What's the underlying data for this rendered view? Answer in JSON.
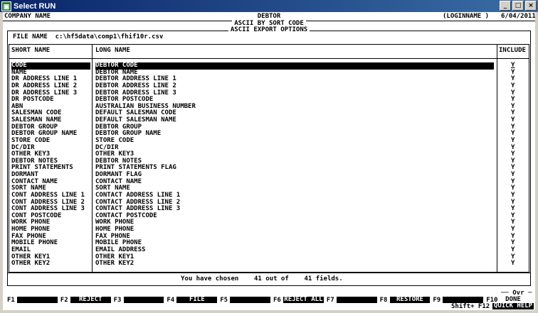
{
  "window": {
    "title": "Select RUN"
  },
  "header": {
    "company": "COMPANY NAME",
    "title": "DEBTOR",
    "subtitle": "ASCII BY SORT CODE",
    "user": "(LOGINNAME )",
    "date": "6/04/2011"
  },
  "box_title": "ASCII EXPORT OPTIONS",
  "file": {
    "label": "FILE NAME",
    "value": "c:\\hf5data\\comp1\\fhif10r.csv"
  },
  "table": {
    "headers": {
      "short": "SHORT NAME",
      "long": "LONG NAME",
      "include": "INCLUDE"
    },
    "rows": [
      {
        "short": "CODE",
        "long": "DEBTOR CODE",
        "include": "Y"
      },
      {
        "short": "NAME",
        "long": "DEBTOR NAME",
        "include": "Y"
      },
      {
        "short": "DR ADDRESS LINE 1",
        "long": "DEBTOR ADDRESS LINE 1",
        "include": "Y"
      },
      {
        "short": "DR ADDRESS LINE 2",
        "long": "DEBTOR ADDRESS LINE 2",
        "include": "Y"
      },
      {
        "short": "DR ADDRESS LINE 3",
        "long": "DEBTOR ADDRESS LINE 3",
        "include": "Y"
      },
      {
        "short": "DR POSTCODE",
        "long": "DEBTOR POSTCODE",
        "include": "Y"
      },
      {
        "short": "ABN",
        "long": "AUSTRALIAN BUSINESS NUMBER",
        "include": "Y"
      },
      {
        "short": "SALESMAN CODE",
        "long": "DEFAULT SALESMAN CODE",
        "include": "Y"
      },
      {
        "short": "SALESMAN NAME",
        "long": "DEFAULT SALESMAN NAME",
        "include": "Y"
      },
      {
        "short": "DEBTOR GROUP",
        "long": "DEBTOR GROUP",
        "include": "Y"
      },
      {
        "short": "DEBTOR GROUP NAME",
        "long": "DEBTOR GROUP NAME",
        "include": "Y"
      },
      {
        "short": "STORE CODE",
        "long": "STORE CODE",
        "include": "Y"
      },
      {
        "short": "DC/DIR",
        "long": "DC/DIR",
        "include": "Y"
      },
      {
        "short": "OTHER KEY3",
        "long": "OTHER KEY3",
        "include": "Y"
      },
      {
        "short": "DEBTOR NOTES",
        "long": "DEBTOR NOTES",
        "include": "Y"
      },
      {
        "short": "PRINT STATEMENTS",
        "long": "PRINT STATEMENTS FLAG",
        "include": "Y"
      },
      {
        "short": "DORMANT",
        "long": "DORMANT FLAG",
        "include": "Y"
      },
      {
        "short": "CONTACT NAME",
        "long": "CONTACT NAME",
        "include": "Y"
      },
      {
        "short": "SORT NAME",
        "long": "SORT NAME",
        "include": "Y"
      },
      {
        "short": "CONT ADDRESS LINE 1",
        "long": "CONTACT ADDRESS LINE 1",
        "include": "Y"
      },
      {
        "short": "CONT ADDRESS LINE 2",
        "long": "CONTACT ADDRESS LINE 2",
        "include": "Y"
      },
      {
        "short": "CONT ADDRESS LINE 3",
        "long": "CONTACT ADDRESS LINE 3",
        "include": "Y"
      },
      {
        "short": "CONT POSTCODE",
        "long": "CONTACT POSTCODE",
        "include": "Y"
      },
      {
        "short": "WORK PHONE",
        "long": "WORK PHONE",
        "include": "Y"
      },
      {
        "short": "HOME PHONE",
        "long": "HOME PHONE",
        "include": "Y"
      },
      {
        "short": "FAX PHONE",
        "long": "FAX PHONE",
        "include": "Y"
      },
      {
        "short": "MOBILE PHONE",
        "long": "MOBILE PHONE",
        "include": "Y"
      },
      {
        "short": "EMAIL",
        "long": "EMAIL ADDRESS",
        "include": "Y"
      },
      {
        "short": "OTHER KEY1",
        "long": "OTHER KEY1",
        "include": "Y"
      },
      {
        "short": "OTHER KEY2",
        "long": "OTHER KEY2",
        "include": "Y"
      }
    ]
  },
  "summary": {
    "prefix": "You have chosen",
    "chosen": "41",
    "middle": "out of",
    "total": "41",
    "suffix": "fields."
  },
  "footer": {
    "ovr": "Ovr",
    "keys": [
      {
        "key": "F1",
        "label": ""
      },
      {
        "key": "F2",
        "label": "REJECT"
      },
      {
        "key": "F3",
        "label": ""
      },
      {
        "key": "F4",
        "label": "FILE"
      },
      {
        "key": "F5",
        "label": ""
      },
      {
        "key": "F6",
        "label": "REJECT ALL"
      },
      {
        "key": "F7",
        "label": ""
      },
      {
        "key": "F8",
        "label": "RESTORE"
      },
      {
        "key": "F9",
        "label": ""
      },
      {
        "key": "F10",
        "label": "DONE"
      }
    ],
    "shift_f12": "Shift+ F12",
    "quick_help": "QUICK HELP"
  },
  "selected_row": 0
}
